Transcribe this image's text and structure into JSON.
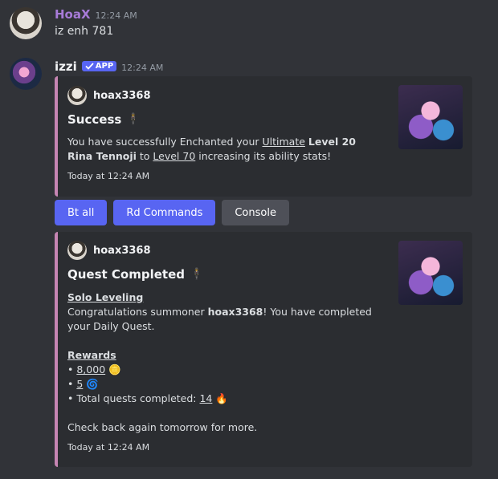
{
  "user_message": {
    "username": "HoaX",
    "username_color": "#a77bd8",
    "timestamp": "12:24 AM",
    "text": "iz enh 781"
  },
  "bot_message": {
    "username": "izzi",
    "badge": "APP",
    "timestamp": "12:24 AM"
  },
  "embed1": {
    "author": "hoax3368",
    "title": "Success",
    "desc_p1": "You have successfully Enchanted your ",
    "desc_link1": "Ultimate",
    "desc_p2": " ",
    "desc_bold": "Level 20 Rina Tennoji",
    "desc_p3": " to ",
    "desc_link2": "Level 70",
    "desc_p4": " increasing its ability stats!",
    "footer": "Today at 12:24 AM"
  },
  "buttons": {
    "bt_all": "Bt all",
    "rd_commands": "Rd Commands",
    "console": "Console"
  },
  "embed2": {
    "author": "hoax3368",
    "title": "Quest Completed",
    "section_title": "Solo Leveling",
    "congrats_p1": "Congratulations summoner ",
    "congrats_bold": "hoax3368",
    "congrats_p2": "! You have completed your Daily Quest.",
    "rewards_title": "Rewards",
    "reward1_value": "8,000",
    "reward2_value": "5",
    "reward3_label": "Total quests completed: ",
    "reward3_value": "14",
    "bullet": "•",
    "closing": "Check back again tomorrow for more.",
    "footer": "Today at 12:24 AM"
  },
  "colors": {
    "background": "#313338",
    "embed_background": "#2b2d31",
    "embed_accent": "#c685b3",
    "blurple": "#5865f2",
    "secondary_button": "#4e5058"
  },
  "icons": {
    "title_icon": "figure-icon",
    "coin_icon": "coin-icon",
    "swirl_icon": "swirl-icon",
    "fire_icon": "fire-icon"
  }
}
